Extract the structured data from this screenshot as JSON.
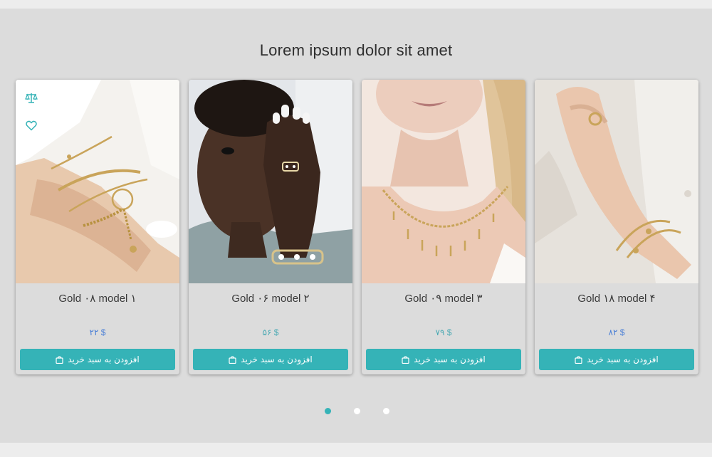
{
  "section": {
    "title": "Lorem ipsum dolor sit amet"
  },
  "colors": {
    "accent": "#35b3b7",
    "price_blue": "#4a7fd6",
    "price_teal": "#4aa9b3",
    "band_bg": "#dcdcdc",
    "outer_bg": "#ededed"
  },
  "card_actions": {
    "compare_icon": "scale-icon",
    "wishlist_icon": "heart-icon"
  },
  "products": [
    {
      "title": "Gold ۰۸ model ۱",
      "price": "۲۲ $",
      "price_color": "#4a7fd6",
      "button_label": "افزودن به سبد خرید",
      "button_icon": "shopping-bag-icon",
      "image": "bracelets-on-wrist"
    },
    {
      "title": "Gold ۰۶ model ۲",
      "price": "۵۶ $",
      "price_color": "#4aa9b3",
      "button_label": "افزودن به سبد خرید",
      "button_icon": "shopping-bag-icon",
      "image": "woman-hand-rings"
    },
    {
      "title": "Gold ۰۹ model ۳",
      "price": "۷۹ $",
      "price_color": "#4aa9b3",
      "button_label": "افزودن به سبد خرید",
      "button_icon": "shopping-bag-icon",
      "image": "gold-necklace"
    },
    {
      "title": "Gold ۱۸ model ۴",
      "price": "۸۲ $",
      "price_color": "#4a7fd6",
      "button_label": "افزودن به سبد خرید",
      "button_icon": "shopping-bag-icon",
      "image": "wrist-cuff-and-ring"
    }
  ],
  "carousel": {
    "pages": 3,
    "active_page": 1
  }
}
